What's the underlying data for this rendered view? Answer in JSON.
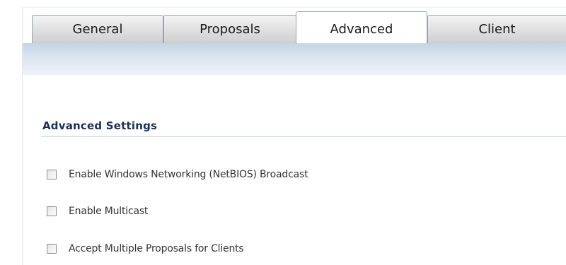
{
  "tabs": [
    {
      "label": "General",
      "active": false
    },
    {
      "label": "Proposals",
      "active": false
    },
    {
      "label": "Advanced",
      "active": true
    },
    {
      "label": "Client",
      "active": false
    }
  ],
  "section": {
    "title": "Advanced Settings"
  },
  "options": [
    {
      "label": "Enable Windows Networking (NetBIOS) Broadcast",
      "checked": false
    },
    {
      "label": "Enable Multicast",
      "checked": false
    },
    {
      "label": "Accept Multiple Proposals for Clients",
      "checked": false
    }
  ],
  "colors": {
    "section_title": "#1b3150",
    "tab_band": "#c5d3e3",
    "rule": "#c9d4e2"
  }
}
